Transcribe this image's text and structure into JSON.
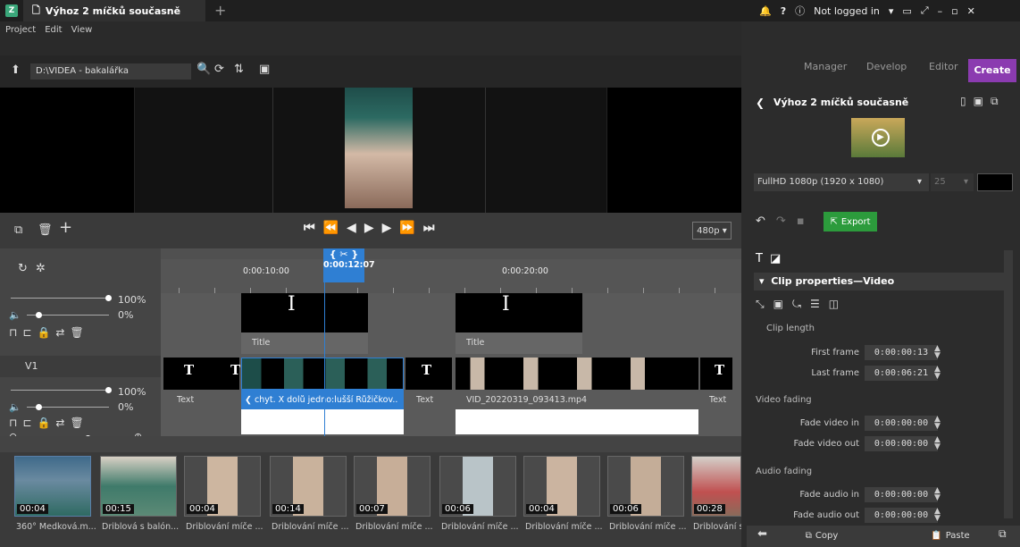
{
  "window": {
    "tab_title": "Výhoz 2 míčků současně",
    "new_tab": "+",
    "user": "Not logged in",
    "bell": "bell-icon",
    "help": "?"
  },
  "menu": [
    "Project",
    "Edit",
    "View"
  ],
  "path": {
    "value": "D:\\VIDEA - bakalářka"
  },
  "nav": {
    "tabs": [
      "Manager",
      "Develop",
      "Editor"
    ],
    "active": "Create"
  },
  "project": {
    "title": "Výhoz 2 míčků současně",
    "resolution": "FullHD 1080p (1920 x 1080)",
    "fps": "25",
    "export": "Export"
  },
  "controls": {
    "quality": "480p"
  },
  "timeline": {
    "times": [
      "0:00:10:00",
      "0:00:12:07",
      "0:00:20:00"
    ],
    "volume_pct": "100%",
    "mute_pct": "0%",
    "volume2_pct": "100%",
    "mute2_pct": "0%",
    "track_v1": "V1",
    "title_labels": [
      "Title",
      "Title"
    ],
    "text_labels": [
      "Text",
      "Text",
      "Text",
      "Text"
    ],
    "selected_clip": "chyt. X dolů jedno:lušší Růžičkov...",
    "video_clip": "VID_20220319_093413.mp4"
  },
  "props": {
    "section": "Clip properties—Video",
    "clip_length": "Clip length",
    "first_frame_label": "First frame",
    "first_frame": "0:00:00:13",
    "last_frame_label": "Last frame",
    "last_frame": "0:00:06:21",
    "video_fading": "Video fading",
    "fade_in_label": "Fade video in",
    "fade_in": "0:00:00:00",
    "fade_out_label": "Fade video out",
    "fade_out": "0:00:00:00",
    "audio_fading": "Audio fading",
    "afade_in_label": "Fade audio in",
    "afade_in": "0:00:00:00",
    "afade_out_label": "Fade audio out",
    "afade_out": "0:00:00:00"
  },
  "bottom": {
    "copy": "Copy",
    "paste": "Paste"
  },
  "bin": [
    {
      "time": "00:04",
      "label": "360° Medková.m..."
    },
    {
      "time": "00:15",
      "label": "Driblová s balón..."
    },
    {
      "time": "00:04",
      "label": "Driblování míče ..."
    },
    {
      "time": "00:14",
      "label": "Driblování míče ..."
    },
    {
      "time": "00:07",
      "label": "Driblování míče ..."
    },
    {
      "time": "00:06",
      "label": "Driblování míče ..."
    },
    {
      "time": "00:04",
      "label": "Driblování míče ..."
    },
    {
      "time": "00:06",
      "label": "Driblování míče ..."
    },
    {
      "time": "00:28",
      "label": "Driblování s"
    }
  ]
}
